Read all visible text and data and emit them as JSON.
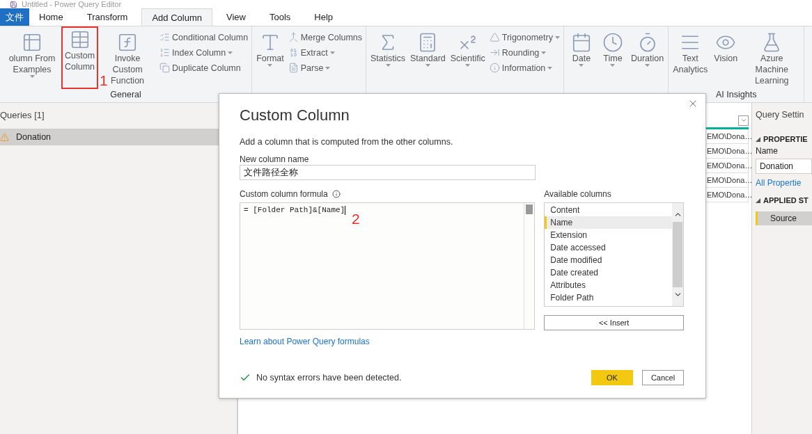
{
  "window": {
    "title": "Untitled - Power Query Editor"
  },
  "menu_tabs": [
    {
      "label": "文件",
      "kind": "file",
      "selected": false
    },
    {
      "label": "Home",
      "kind": "tab",
      "selected": false
    },
    {
      "label": "Transform",
      "kind": "tab",
      "selected": false
    },
    {
      "label": "Add Column",
      "kind": "tab",
      "selected": true
    },
    {
      "label": "View",
      "kind": "tab",
      "selected": false
    },
    {
      "label": "Tools",
      "kind": "tab",
      "selected": false
    },
    {
      "label": "Help",
      "kind": "tab",
      "selected": false
    }
  ],
  "ribbon": {
    "groups": [
      {
        "label": "General",
        "large": [
          {
            "label": "olumn From Examples",
            "dropdown": true,
            "highlighted": false
          },
          {
            "label": "Custom Column",
            "dropdown": false,
            "highlighted": true
          },
          {
            "label": "Invoke Custom Function",
            "dropdown": false,
            "highlighted": false
          }
        ],
        "small": [
          {
            "label": "Conditional Column",
            "dropdown": false
          },
          {
            "label": "Index Column",
            "dropdown": true
          },
          {
            "label": "Duplicate Column",
            "dropdown": false
          }
        ]
      },
      {
        "large": [
          {
            "label": "Format",
            "dropdown": true,
            "highlighted": false
          }
        ],
        "small": [
          {
            "label": "Merge Columns",
            "dropdown": false
          },
          {
            "label": "Extract",
            "dropdown": true
          },
          {
            "label": "Parse",
            "dropdown": true
          }
        ]
      },
      {
        "large": [
          {
            "label": "Statistics",
            "dropdown": true,
            "highlighted": false
          },
          {
            "label": "Standard",
            "dropdown": true,
            "highlighted": false
          },
          {
            "label": "Scientific",
            "dropdown": true,
            "highlighted": false
          }
        ],
        "small": [
          {
            "label": "Trigonometry",
            "dropdown": true
          },
          {
            "label": "Rounding",
            "dropdown": true
          },
          {
            "label": "Information",
            "dropdown": true
          }
        ]
      },
      {
        "large": [
          {
            "label": "Date",
            "dropdown": true,
            "highlighted": false
          },
          {
            "label": "Time",
            "dropdown": true,
            "highlighted": false
          },
          {
            "label": "Duration",
            "dropdown": true,
            "highlighted": false
          }
        ]
      },
      {
        "label": "AI Insights",
        "large": [
          {
            "label": "Text Analytics",
            "dropdown": false,
            "highlighted": false
          },
          {
            "label": "Vision",
            "dropdown": false,
            "highlighted": false
          },
          {
            "label": "Azure Machine Learning",
            "dropdown": false,
            "highlighted": false
          }
        ]
      }
    ]
  },
  "annotations": [
    {
      "label": "1"
    },
    {
      "label": "2"
    }
  ],
  "queries": {
    "title": "Queries [1]",
    "items": [
      {
        "label": "Donation",
        "selected": true
      }
    ]
  },
  "grid": {
    "rows": [
      "EMO\\Dona…",
      "EMO\\Dona…",
      "EMO\\Dona…",
      "EMO\\Dona…",
      "EMO\\Dona…"
    ]
  },
  "query_settings": {
    "title": "Query Settin",
    "properties_heading": "PROPERTIE",
    "name_label": "Name",
    "name_value": "Donation",
    "all_properties_link": "All Propertie",
    "applied_steps_heading": "APPLIED ST",
    "steps": [
      {
        "label": "Source",
        "selected": true
      }
    ]
  },
  "dialog": {
    "title": "Custom Column",
    "description": "Add a column that is computed from the other columns.",
    "name_label": "New column name",
    "name_value": "文件路径全称",
    "formula_label": "Custom column formula",
    "formula": "= [Folder Path]&[Name]",
    "available_label": "Available columns",
    "columns": [
      {
        "label": "Content",
        "selected": false
      },
      {
        "label": "Name",
        "selected": true
      },
      {
        "label": "Extension",
        "selected": false
      },
      {
        "label": "Date accessed",
        "selected": false
      },
      {
        "label": "Date modified",
        "selected": false
      },
      {
        "label": "Date created",
        "selected": false
      },
      {
        "label": "Attributes",
        "selected": false
      },
      {
        "label": "Folder Path",
        "selected": false
      }
    ],
    "insert_button": "<< Insert",
    "link": "Learn about Power Query formulas",
    "status": "No syntax errors have been detected.",
    "buttons": [
      {
        "label": "OK",
        "kind": "primary"
      },
      {
        "label": "Cancel",
        "kind": "secondary"
      }
    ]
  }
}
